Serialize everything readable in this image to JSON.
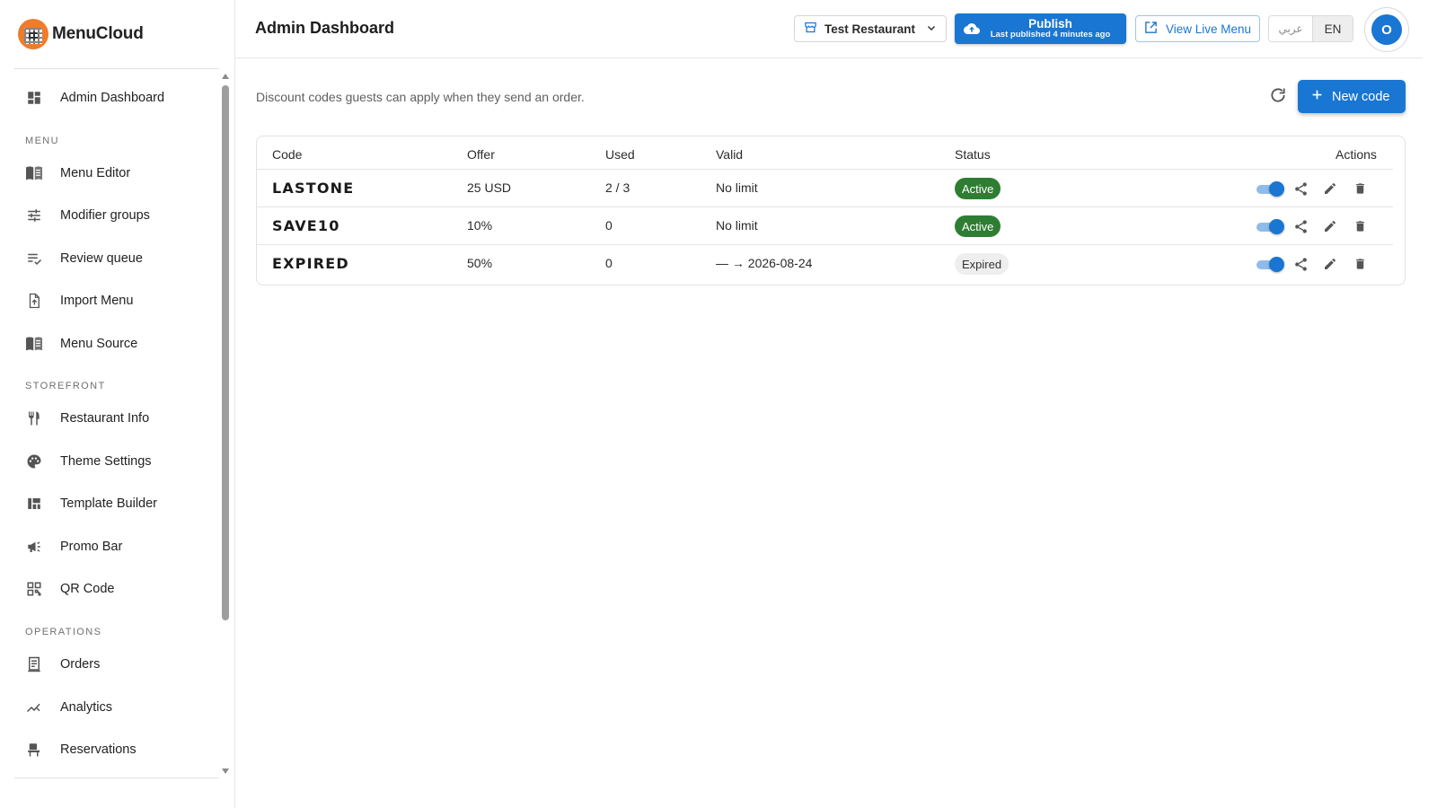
{
  "app": {
    "name": "MenuCloud"
  },
  "header": {
    "title": "Admin Dashboard",
    "restaurant": "Test Restaurant",
    "publish_label": "Publish",
    "publish_sub": "Last published 4 minutes ago",
    "view_live_label": "View Live Menu",
    "lang_ar": "عربي",
    "lang_en": "EN",
    "avatar_initial": "O"
  },
  "sidebar": {
    "items": [
      {
        "label": "Admin Dashboard",
        "icon": "dashboard-icon"
      },
      {
        "section": "MENU"
      },
      {
        "label": "Menu Editor",
        "icon": "book-icon"
      },
      {
        "label": "Modifier groups",
        "icon": "sliders-icon"
      },
      {
        "label": "Review queue",
        "icon": "checklist-icon"
      },
      {
        "label": "Import Menu",
        "icon": "file-upload-icon"
      },
      {
        "label": "Menu Source",
        "icon": "book-icon"
      },
      {
        "section": "STOREFRONT"
      },
      {
        "label": "Restaurant Info",
        "icon": "utensils-icon"
      },
      {
        "label": "Theme Settings",
        "icon": "palette-icon"
      },
      {
        "label": "Template Builder",
        "icon": "layout-icon"
      },
      {
        "label": "Promo Bar",
        "icon": "megaphone-icon"
      },
      {
        "label": "QR Code",
        "icon": "qr-icon"
      },
      {
        "section": "OPERATIONS"
      },
      {
        "label": "Orders",
        "icon": "receipt-icon"
      },
      {
        "label": "Analytics",
        "icon": "analytics-icon"
      },
      {
        "label": "Reservations",
        "icon": "chair-icon"
      }
    ]
  },
  "main": {
    "description": "Discount codes guests can apply when they send an order.",
    "new_code_label": "New code",
    "table": {
      "headers": {
        "code": "Code",
        "offer": "Offer",
        "used": "Used",
        "valid": "Valid",
        "status": "Status",
        "actions": "Actions"
      },
      "rows": [
        {
          "code": "LASTONE",
          "offer": "25 USD",
          "used": "2 / 3",
          "valid": "No limit",
          "status": "Active",
          "enabled": true
        },
        {
          "code": "SAVE10",
          "offer": "10%",
          "used": "0",
          "valid": "No limit",
          "status": "Active",
          "enabled": true
        },
        {
          "code": "EXPIRED",
          "offer": "50%",
          "used": "0",
          "valid": "— → 2026-08-24",
          "status": "Expired",
          "enabled": true
        }
      ]
    }
  },
  "colors": {
    "primary": "#1976d2",
    "active_badge": "#2e7d32",
    "expired_badge": "#eeeeee"
  }
}
